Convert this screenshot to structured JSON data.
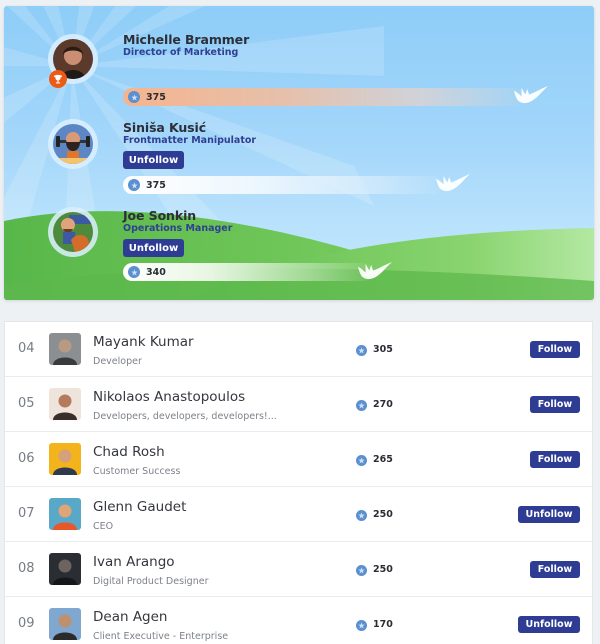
{
  "podium": [
    {
      "name": "Michelle Brammer",
      "title": "Director of Marketing",
      "points": "375",
      "badge": "trophy-icon",
      "button": null,
      "avatar_colors": [
        "#5b3a2c",
        "#c98e74",
        "#1f1a18"
      ]
    },
    {
      "name": "Siniša Kusić",
      "title": "Frontmatter Manipulator",
      "points": "375",
      "button": "Unfollow",
      "avatar_colors": [
        "#5c86c4",
        "#c8794a",
        "#2a2320"
      ]
    },
    {
      "name": "Joe Sonkin",
      "title": "Operations Manager",
      "points": "340",
      "button": "Unfollow",
      "avatar_colors": [
        "#4d8a3c",
        "#d46c2a",
        "#3c5aa3"
      ]
    }
  ],
  "leaderboard": [
    {
      "rank": "04",
      "name": "Mayank Kumar",
      "subtitle": "Developer",
      "points": "305",
      "button": "Follow",
      "avatar_colors": [
        "#8c8f91",
        "#b89a82",
        "#3a3b3c"
      ]
    },
    {
      "rank": "05",
      "name": "Nikolaos Anastopoulos",
      "subtitle": "Developers, developers, developers!...",
      "points": "270",
      "button": "Follow",
      "avatar_colors": [
        "#efe4dc",
        "#b57a5c",
        "#3b2e2a"
      ]
    },
    {
      "rank": "06",
      "name": "Chad Rosh",
      "subtitle": "Customer Success",
      "points": "265",
      "button": "Follow",
      "avatar_colors": [
        "#f2b31b",
        "#d6a07c",
        "#2f3a4e"
      ]
    },
    {
      "rank": "07",
      "name": "Glenn Gaudet",
      "subtitle": "CEO",
      "points": "250",
      "button": "Unfollow",
      "avatar_colors": [
        "#5aa8c8",
        "#e0a479",
        "#e8572a"
      ]
    },
    {
      "rank": "08",
      "name": "Ivan Arango",
      "subtitle": "Digital Product Designer",
      "points": "250",
      "button": "Follow",
      "avatar_colors": [
        "#2a2e33",
        "#6b6460",
        "#15171a"
      ]
    },
    {
      "rank": "09",
      "name": "Dean Agen",
      "subtitle": "Client Executive - Enterprise",
      "points": "170",
      "button": "Unfollow",
      "avatar_colors": [
        "#7fa7cf",
        "#c08f6c",
        "#2b2b2b"
      ]
    }
  ],
  "colors": {
    "button": "#2e3d93",
    "title_accent": "#2f3f92",
    "trophy": "#ec5a15",
    "points_star": "#5a8fd0"
  }
}
